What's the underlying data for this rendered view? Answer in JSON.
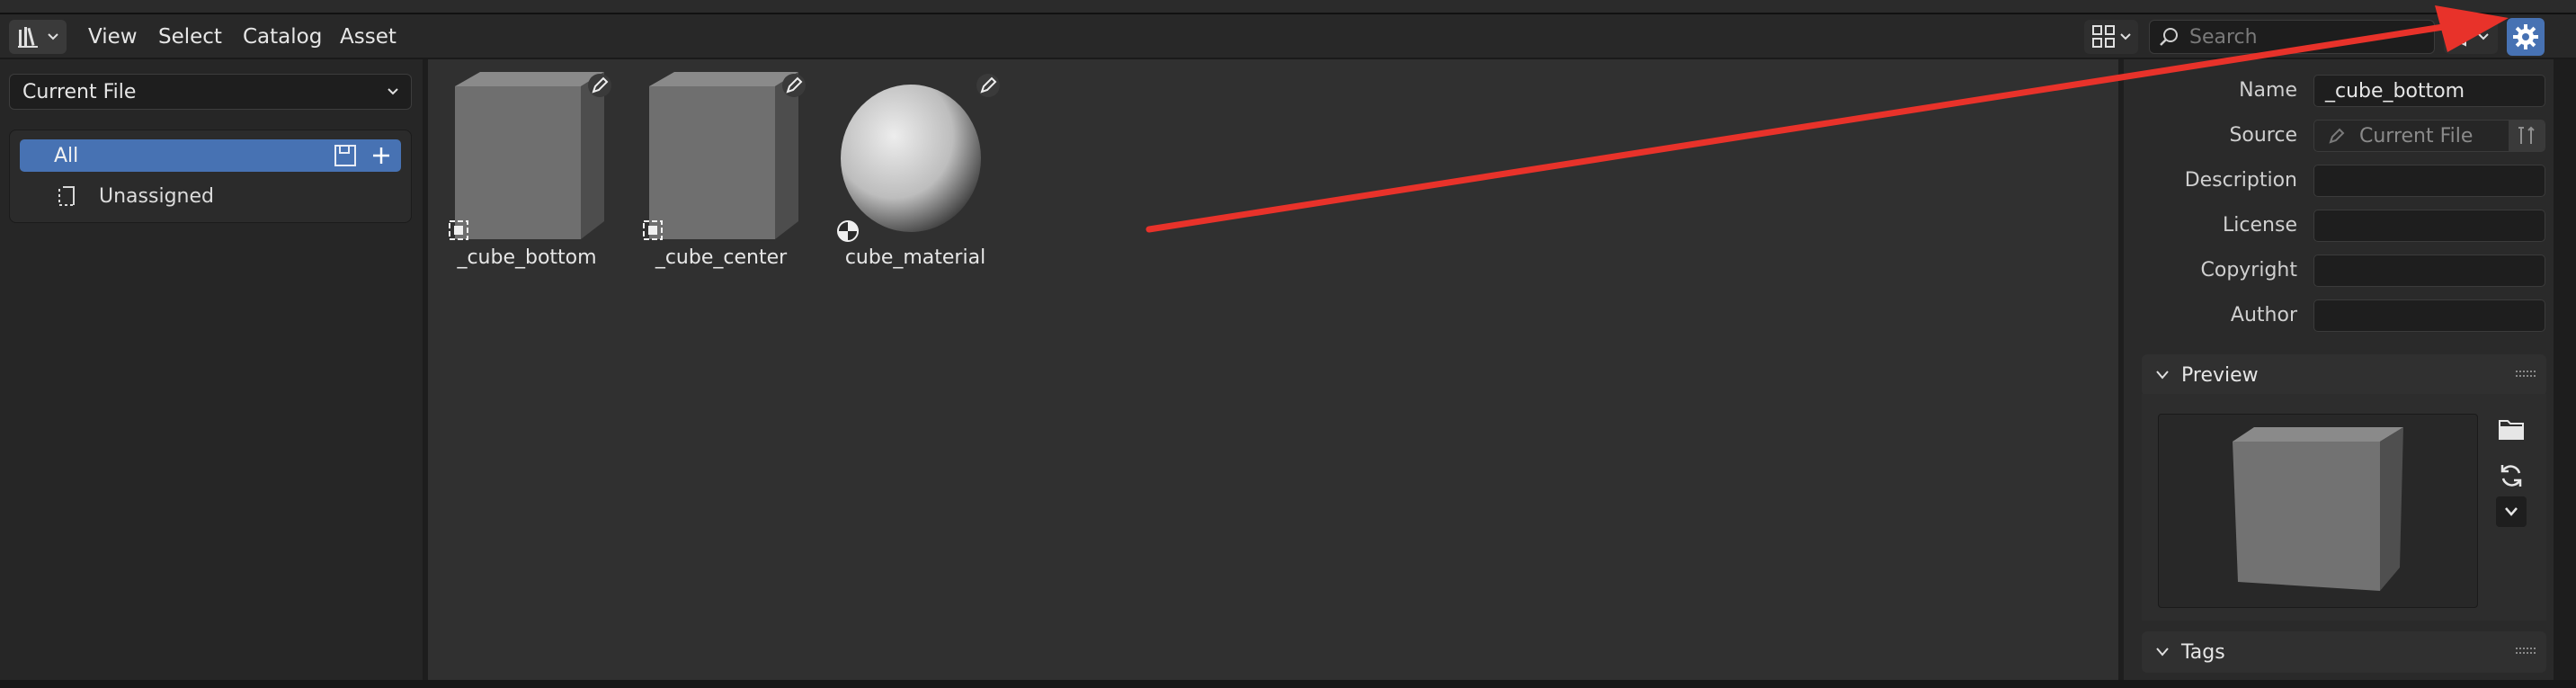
{
  "header": {
    "menus": [
      "View",
      "Select",
      "Catalog",
      "Asset"
    ],
    "search": {
      "placeholder": "Search",
      "value": ""
    }
  },
  "left_panel": {
    "library": "Current File",
    "catalogs": [
      {
        "label": "All",
        "selected": true
      },
      {
        "label": "Unassigned",
        "selected": false
      }
    ]
  },
  "assets": [
    {
      "name": "_cube_bottom",
      "type": "object",
      "preview": "cube"
    },
    {
      "name": "_cube_center",
      "type": "object",
      "preview": "cube"
    },
    {
      "name": "cube_material",
      "type": "material",
      "preview": "sphere"
    }
  ],
  "sidebar": {
    "properties": [
      {
        "label": "Name",
        "value": "_cube_bottom"
      },
      {
        "label": "Source",
        "value": "Current File"
      },
      {
        "label": "Description",
        "value": ""
      },
      {
        "label": "License",
        "value": ""
      },
      {
        "label": "Copyright",
        "value": ""
      },
      {
        "label": "Author",
        "value": ""
      }
    ],
    "panels": {
      "preview": "Preview",
      "tags": "Tags"
    }
  },
  "colors": {
    "accent": "#4772b3",
    "annotation_arrow": "#e8322a"
  }
}
